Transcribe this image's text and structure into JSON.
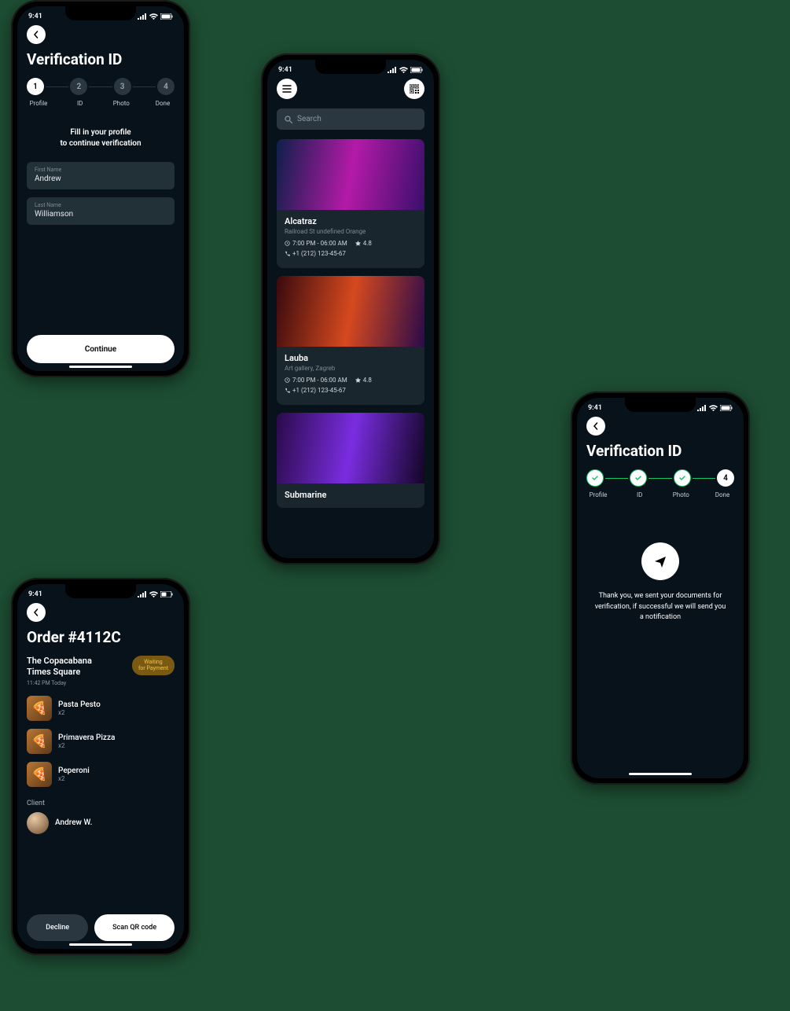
{
  "status_time": "9:41",
  "screen1": {
    "title": "Verification ID",
    "steps": [
      "Profile",
      "ID",
      "Photo",
      "Done"
    ],
    "step_numbers": [
      "1",
      "2",
      "3",
      "4"
    ],
    "active_step": 1,
    "subtitle_line1": "Fill in your profile",
    "subtitle_line2": "to continue verification",
    "first_name_label": "First Name",
    "first_name_value": "Andrew",
    "last_name_label": "Last Name",
    "last_name_value": "Williamson",
    "continue_label": "Continue"
  },
  "screen2": {
    "search_placeholder": "Search",
    "venues": [
      {
        "name": "Alcatraz",
        "address": "Railroad St undefined Orange",
        "hours": "7:00 PM - 06:00 AM",
        "rating": "4.8",
        "phone": "+1 (212) 123-45-67",
        "colors": [
          "#0e1f4a",
          "#b41aa8",
          "#3a0f6a"
        ]
      },
      {
        "name": "Lauba",
        "address": "Art gallery, Zagreb",
        "hours": "7:00 PM - 06:00 AM",
        "rating": "4.8",
        "phone": "+1 (212) 123-45-67",
        "colors": [
          "#3a0a0e",
          "#d6491e",
          "#2a0a4a"
        ]
      },
      {
        "name": "Submarine",
        "address": "",
        "hours": "",
        "rating": "",
        "phone": "",
        "colors": [
          "#2a0a4a",
          "#7a2de0",
          "#120525"
        ]
      }
    ]
  },
  "screen3": {
    "title": "Verification ID",
    "steps": [
      "Profile",
      "ID",
      "Photo",
      "Done"
    ],
    "step_numbers": [
      "",
      "",
      "",
      "4"
    ],
    "active_step": 4,
    "done_message": "Thank you, we sent your documents for verification, if successful we will send you a notification"
  },
  "screen4": {
    "title": "Order #4112C",
    "location_line1": "The Copacabana",
    "location_line2": "Times Square",
    "timestamp": "11:42 PM Today",
    "badge_line1": "Waiting",
    "badge_line2": "for Payment",
    "items": [
      {
        "name": "Pasta Pesto",
        "qty": "x2"
      },
      {
        "name": "Primavera Pizza",
        "qty": "x2"
      },
      {
        "name": "Peperoni",
        "qty": "x2"
      }
    ],
    "client_label": "Client",
    "client_name": "Andrew W.",
    "decline_label": "Decline",
    "scan_label": "Scan QR code"
  }
}
